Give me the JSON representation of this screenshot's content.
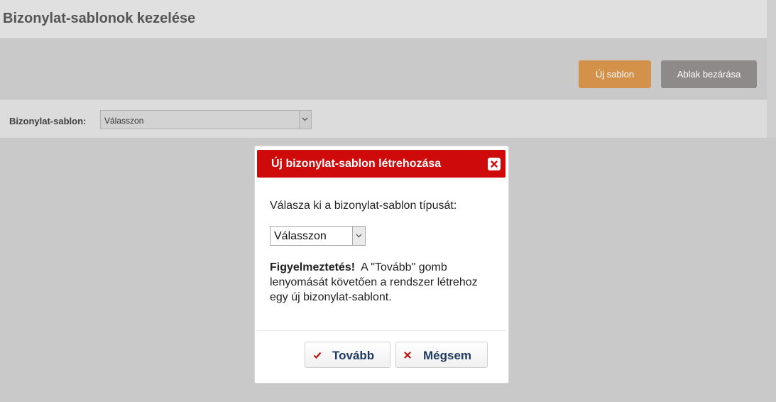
{
  "page": {
    "title": "Bizonylat-sablonok kezelése",
    "toolbar": {
      "new_template_label": "Új sablon",
      "close_window_label": "Ablak bezárása"
    },
    "filter": {
      "label": "Bizonylat-sablon:",
      "selected_value": "Válasszon"
    }
  },
  "dialog": {
    "title": "Új bizonylat-sablon létrehozása",
    "close_icon": "close-icon",
    "prompt": "Válasza ki a bizonylat-sablon típusát:",
    "type_select": {
      "selected_value": "Válasszon"
    },
    "warning": {
      "strong": "Figyelmeztetés!",
      "text": "A \"Tovább\" gomb lenyomását követően a rendszer létrehoz egy új bizonylat-sablont."
    },
    "buttons": {
      "next_label": "Tovább",
      "next_icon": "check-icon",
      "cancel_label": "Mégsem",
      "cancel_icon": "x-icon"
    }
  },
  "colors": {
    "dialog_titlebar": "#cf0a0a",
    "new_button": "#d4914a",
    "close_button": "#8f8a8a",
    "dialog_button_text": "#1f3b63"
  }
}
